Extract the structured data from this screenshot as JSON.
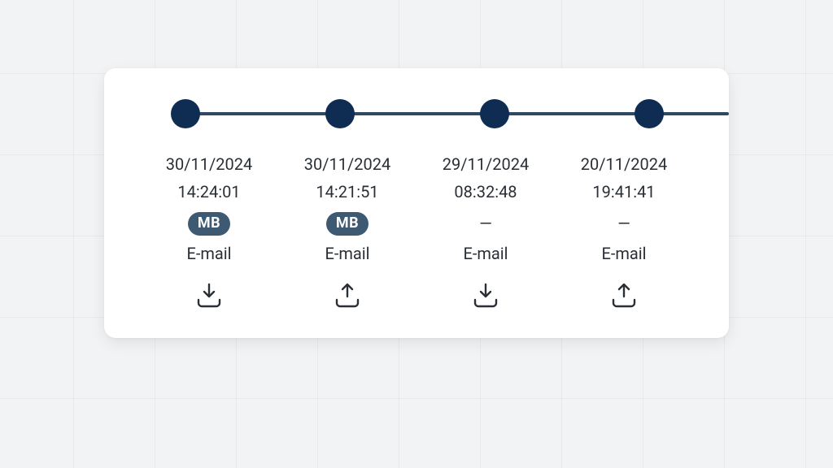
{
  "colors": {
    "dot": "#0f2d52",
    "line": "#2e4a63",
    "badge_bg": "#3e5a73",
    "badge_fg": "#ffffff"
  },
  "timeline": {
    "events": [
      {
        "date": "30/11/2024",
        "time": "14:24:01",
        "user_badge": "MB",
        "channel": "E-mail",
        "direction": "in",
        "action_icon": "download-tray-icon"
      },
      {
        "date": "30/11/2024",
        "time": "14:21:51",
        "user_badge": "MB",
        "channel": "E-mail",
        "direction": "out",
        "action_icon": "upload-tray-icon"
      },
      {
        "date": "29/11/2024",
        "time": "08:32:48",
        "user_badge": null,
        "channel": "E-mail",
        "direction": "in",
        "action_icon": "download-tray-icon"
      },
      {
        "date": "20/11/2024",
        "time": "19:41:41",
        "user_badge": null,
        "channel": "E-mail",
        "direction": "out",
        "action_icon": "upload-tray-icon"
      }
    ]
  }
}
